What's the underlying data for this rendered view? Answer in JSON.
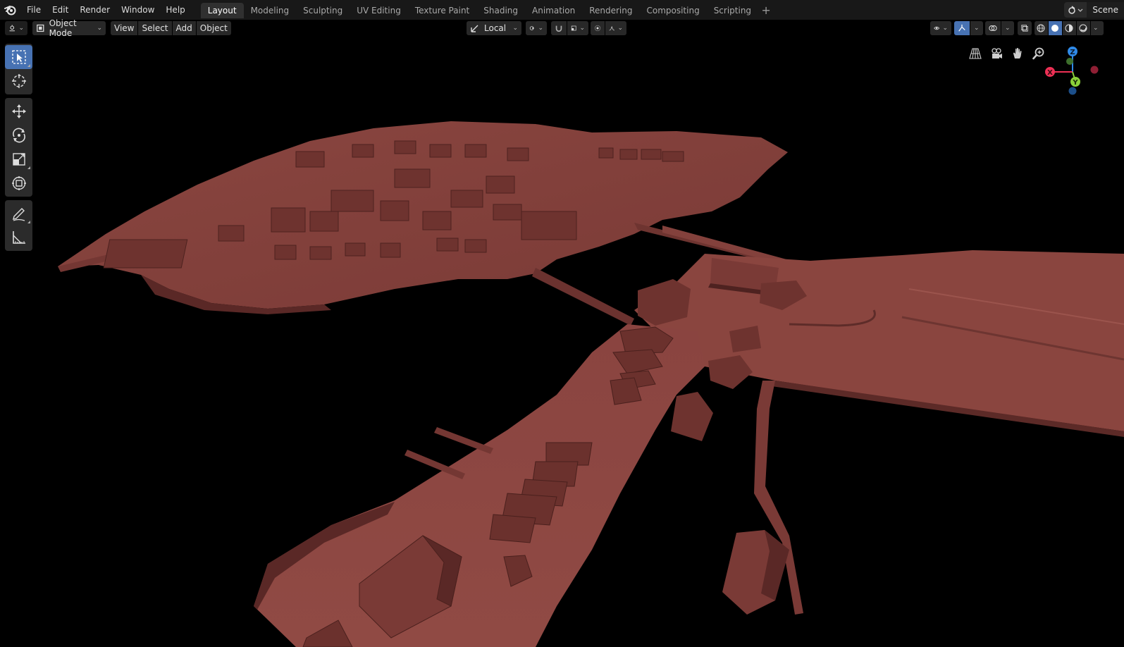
{
  "topbar": {
    "menu": [
      "File",
      "Edit",
      "Render",
      "Window",
      "Help"
    ],
    "tabs": [
      "Layout",
      "Modeling",
      "Sculpting",
      "UV Editing",
      "Texture Paint",
      "Shading",
      "Animation",
      "Rendering",
      "Compositing",
      "Scripting"
    ],
    "active_tab": "Layout",
    "add_tab_label": "+",
    "scene_label": "Scene"
  },
  "header": {
    "mode_label": "Object Mode",
    "menu": [
      "View",
      "Select",
      "Add",
      "Object"
    ],
    "orientation_label": "Local"
  },
  "toolbar": {
    "tools": [
      "select-box-tool",
      "cursor-tool",
      "move-tool",
      "rotate-tool",
      "scale-tool",
      "transform-tool",
      "annotate-tool",
      "measure-tool"
    ],
    "active_tool": "select-box-tool"
  },
  "gizmo": {
    "x_label": "X",
    "y_label": "Y",
    "z_label": "Z",
    "x_color": "#ee3055",
    "y_color": "#8bd13a",
    "z_color": "#2f8ae8"
  },
  "colors": {
    "model": "#7a3a36",
    "model_light": "#9a514a",
    "model_dark": "#4e2220",
    "accent": "#4772b3"
  }
}
